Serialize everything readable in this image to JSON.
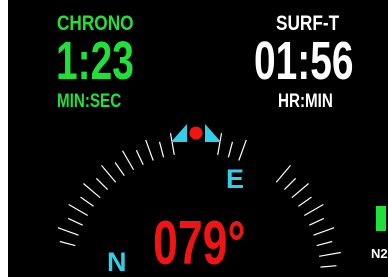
{
  "chrono": {
    "label": "CHRONO",
    "value": "1:23",
    "unit": "MIN:SEC"
  },
  "surface_time": {
    "label": "SURF-T",
    "value": "01:56",
    "unit": "HR:MIN"
  },
  "compass": {
    "heading": "079°",
    "directions": {
      "east": "E",
      "north": "N"
    },
    "colors": {
      "ticks": "#ffffff",
      "cardinal": "#2fd0e8",
      "heading": "#f01414",
      "marker": "#2fd0e8",
      "marker_dot": "#f01414"
    }
  },
  "n2_gauge": {
    "label": "N2",
    "color": "#22e03a"
  },
  "colors": {
    "background": "#000000",
    "primary": "#22e03a",
    "secondary": "#ffffff"
  }
}
